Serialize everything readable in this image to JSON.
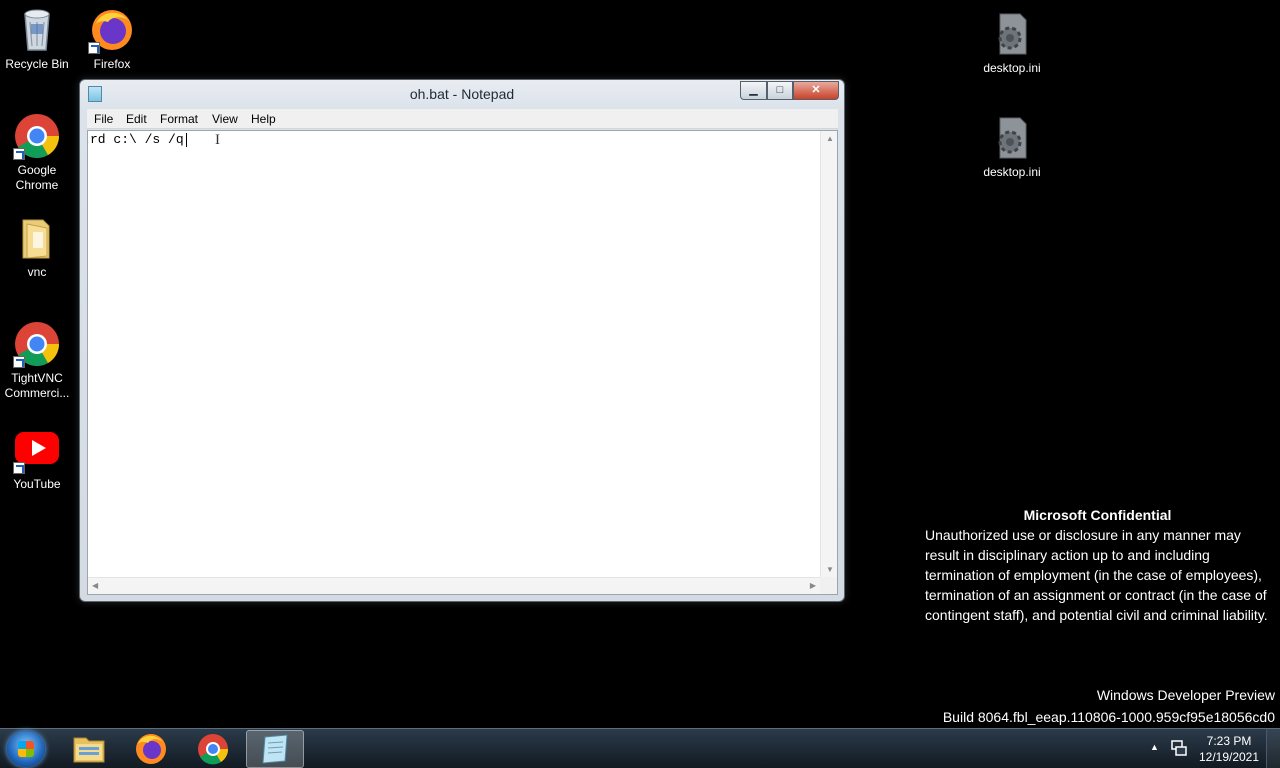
{
  "desktop": {
    "icons_left": [
      {
        "label": "Recycle Bin"
      },
      {
        "label": "Firefox"
      },
      {
        "label": "Google Chrome"
      },
      {
        "label": "vnc"
      },
      {
        "label": "TightVNC Commerci..."
      },
      {
        "label": "YouTube"
      }
    ],
    "icons_right": [
      {
        "label": "desktop.ini"
      },
      {
        "label": "desktop.ini"
      }
    ]
  },
  "notepad": {
    "title": "oh.bat - Notepad",
    "menu": [
      "File",
      "Edit",
      "Format",
      "View",
      "Help"
    ],
    "content": "rd c:\\ /s /q",
    "buttons": {
      "minimize": "▁",
      "maximize": "□",
      "close": "✕"
    }
  },
  "notice": {
    "title": "Microsoft Confidential",
    "body": "Unauthorized use or disclosure in any manner may result in disciplinary action up to and including termination of employment (in the case of employees), termination of an assignment or contract (in the case of contingent staff), and potential civil and criminal liability."
  },
  "watermark": {
    "line1": "Windows Developer Preview",
    "line2": "Build 8064.fbl_eeap.110806-1000.959cf95e18056cd0"
  },
  "taskbar": {
    "pinned": [
      "start-button",
      "explorer-icon",
      "firefox-icon",
      "chrome-icon",
      "notepad-icon"
    ],
    "clock_time": "7:23 PM",
    "clock_date": "12/19/2021",
    "tray_arrow": "▲"
  },
  "colors": {
    "desktop_bg": "#000000",
    "close_button": "#c8422a",
    "taskbar": "#1a2530"
  }
}
